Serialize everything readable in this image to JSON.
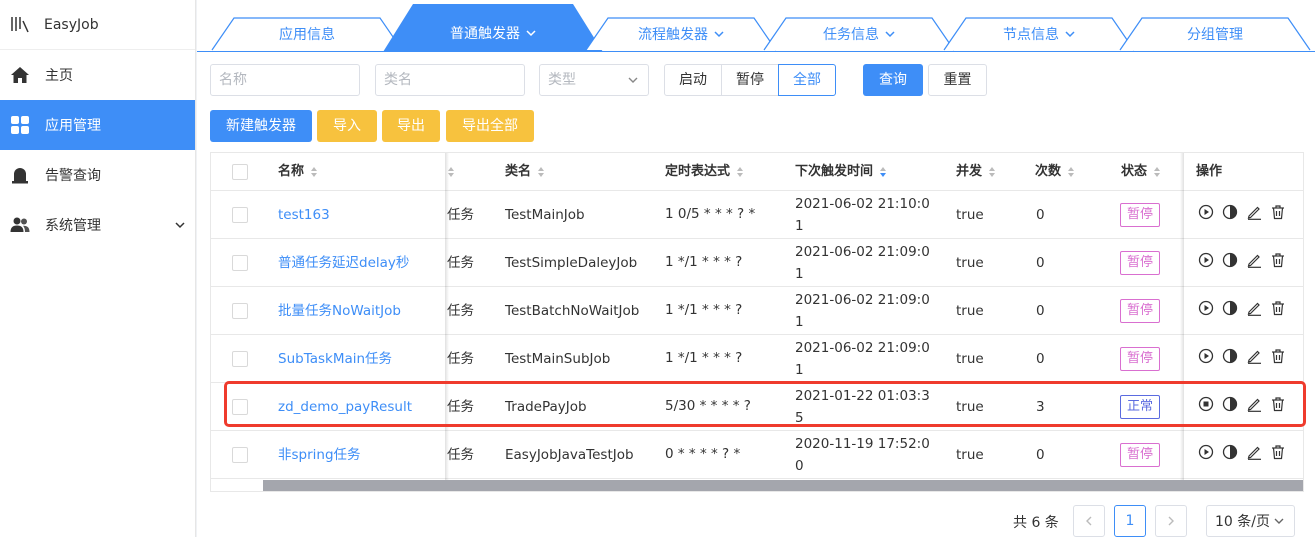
{
  "app": {
    "title": "EasyJob"
  },
  "sidebar": {
    "items": [
      {
        "label": "主页",
        "icon": "home-icon"
      },
      {
        "label": "应用管理",
        "icon": "grid-icon",
        "active": true
      },
      {
        "label": "告警查询",
        "icon": "alarm-icon"
      },
      {
        "label": "系统管理",
        "icon": "users-icon",
        "has_children": true
      }
    ]
  },
  "tabs": [
    {
      "label": "应用信息"
    },
    {
      "label": "普通触发器",
      "active": true,
      "dropdown": true
    },
    {
      "label": "流程触发器",
      "dropdown": true
    },
    {
      "label": "任务信息",
      "dropdown": true
    },
    {
      "label": "节点信息",
      "dropdown": true
    },
    {
      "label": "分组管理"
    }
  ],
  "filters": {
    "name_placeholder": "名称",
    "class_placeholder": "类名",
    "type_placeholder": "类型",
    "status_options": [
      "启动",
      "暂停",
      "全部"
    ],
    "status_selected": "全部",
    "query_label": "查询",
    "reset_label": "重置"
  },
  "actions": {
    "new_label": "新建触发器",
    "import_label": "导入",
    "export_label": "导出",
    "export_all_label": "导出全部"
  },
  "table": {
    "headers": {
      "name": "名称",
      "class": "类名",
      "cron": "定时表达式",
      "next": "下次触发时间",
      "concurrent": "并发",
      "count": "次数",
      "status": "状态",
      "ops": "操作"
    },
    "rows": [
      {
        "name": "test163",
        "type": "任务",
        "class": "TestMainJob",
        "cron": "1 0/5 * * * ? *",
        "next": "2021-06-02 21:10:01",
        "concurrent": "true",
        "count": "0",
        "status": "暂停",
        "running": false
      },
      {
        "name": "普通任务延迟delay秒",
        "type": "任务",
        "class": "TestSimpleDaleyJob",
        "cron": "1 */1 * * * ?",
        "next": "2021-06-02 21:09:01",
        "concurrent": "true",
        "count": "0",
        "status": "暂停",
        "running": false
      },
      {
        "name": "批量任务NoWaitJob",
        "type": "任务",
        "class": "TestBatchNoWaitJob",
        "cron": "1 */1 * * * ?",
        "next": "2021-06-02 21:09:01",
        "concurrent": "true",
        "count": "0",
        "status": "暂停",
        "running": false
      },
      {
        "name": "SubTaskMain任务",
        "type": "任务",
        "class": "TestMainSubJob",
        "cron": "1 */1 * * * ?",
        "next": "2021-06-02 21:09:01",
        "concurrent": "true",
        "count": "0",
        "status": "暂停",
        "running": false
      },
      {
        "name": "zd_demo_payResult",
        "type": "任务",
        "class": "TradePayJob",
        "cron": "5/30 * * * * ?",
        "next": "2021-01-22 01:03:35",
        "concurrent": "true",
        "count": "3",
        "status": "正常",
        "running": true,
        "highlighted": true
      },
      {
        "name": "非spring任务",
        "type": "任务",
        "class": "EasyJobJavaTestJob",
        "cron": "0 * * * * ? *",
        "next": "2020-11-19 17:52:00",
        "concurrent": "true",
        "count": "0",
        "status": "暂停",
        "running": false
      }
    ]
  },
  "pagination": {
    "total_text": "共 6 条",
    "current_page": "1",
    "page_size": "10 条/页"
  },
  "colors": {
    "primary": "#3e8ef7",
    "warning": "#f7c23e",
    "paused_tag": "#d96fd0",
    "normal_tag": "#5b6be0",
    "highlight": "#ef3b2d"
  }
}
